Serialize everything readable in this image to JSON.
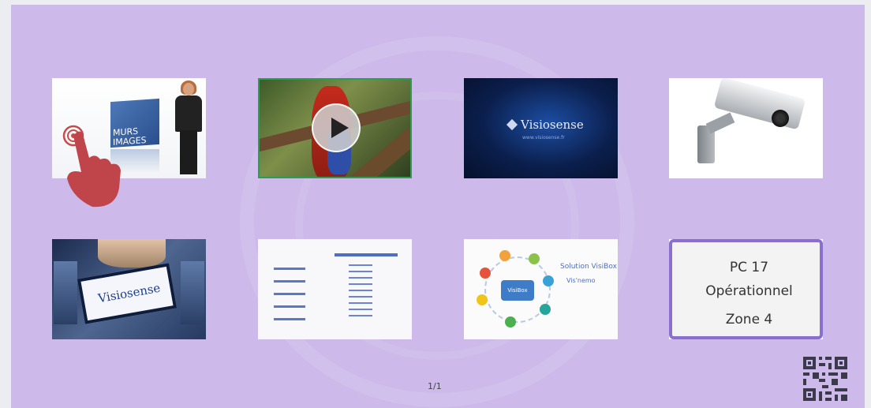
{
  "tiles": [
    {
      "id": "video-intro",
      "caption_lines": [
        "MURS",
        "IMAGES"
      ]
    },
    {
      "id": "parrot-video",
      "control": "play-icon"
    },
    {
      "id": "visiosense-logo",
      "brand": "Visiosense",
      "url": "www.visiosense.fr"
    },
    {
      "id": "security-camera"
    },
    {
      "id": "visiosense-screen",
      "brand": "Visiosense"
    },
    {
      "id": "slides-document"
    },
    {
      "id": "visibox-diagram",
      "title": "Solution VisiBox",
      "subtitle": "Vis'nemo",
      "center_label": "VisiBox"
    },
    {
      "id": "pc17-card",
      "lines": [
        "PC 17",
        "Opérationnel",
        "Zone 4"
      ]
    }
  ],
  "pagination": {
    "text": "1/1"
  },
  "colors": {
    "background": "#cdb9ea",
    "card_border": "#8a6fcf",
    "selected_border": "#2e9e4a"
  },
  "icons": {
    "cursor": "hand-pointer-icon",
    "qr": "qr-code-icon"
  }
}
